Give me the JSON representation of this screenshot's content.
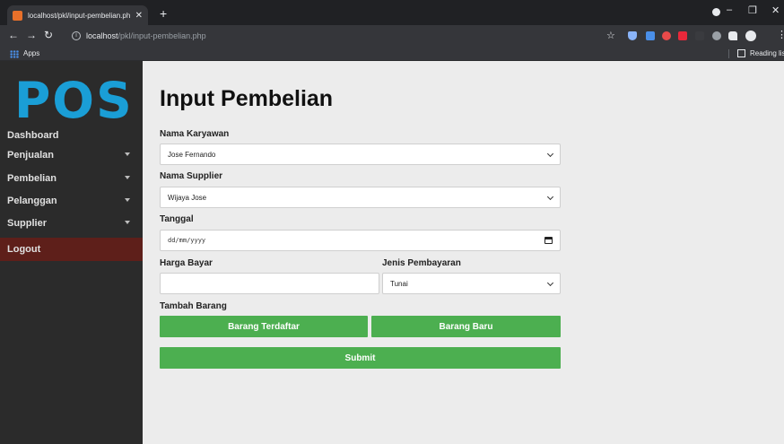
{
  "browser": {
    "tab_title": "localhost/pkl/input-pembelian.ph",
    "url_host": "localhost",
    "url_path": "/pkl/input-pembelian.php",
    "bookmarks": {
      "apps": "Apps",
      "reading_list": "Reading list"
    }
  },
  "sidebar": {
    "logo": "POS",
    "items": [
      {
        "label": "Dashboard",
        "has_caret": false
      },
      {
        "label": "Penjualan",
        "has_caret": true
      },
      {
        "label": "Pembelian",
        "has_caret": true
      },
      {
        "label": "Pelanggan",
        "has_caret": true
      },
      {
        "label": "Supplier",
        "has_caret": true
      }
    ],
    "logout": "Logout"
  },
  "form": {
    "title": "Input Pembelian",
    "karyawan": {
      "label": "Nama Karyawan",
      "value": "Jose Fernando"
    },
    "supplier": {
      "label": "Nama Supplier",
      "value": "Wijaya Jose"
    },
    "tanggal": {
      "label": "Tanggal",
      "placeholder": "dd/mm/yyyy"
    },
    "harga_bayar": {
      "label": "Harga Bayar",
      "value": ""
    },
    "jenis_pembayaran": {
      "label": "Jenis Pembayaran",
      "value": "Tunai"
    },
    "tambah_barang": {
      "label": "Tambah Barang",
      "registered_button": "Barang Terdaftar",
      "new_button": "Barang Baru"
    },
    "submit": "Submit"
  },
  "colors": {
    "accent_green": "#4caf50",
    "logo_blue": "#1a9ed6",
    "sidebar_bg": "#2b2b2b",
    "logout_bg": "#5e1f1a"
  }
}
